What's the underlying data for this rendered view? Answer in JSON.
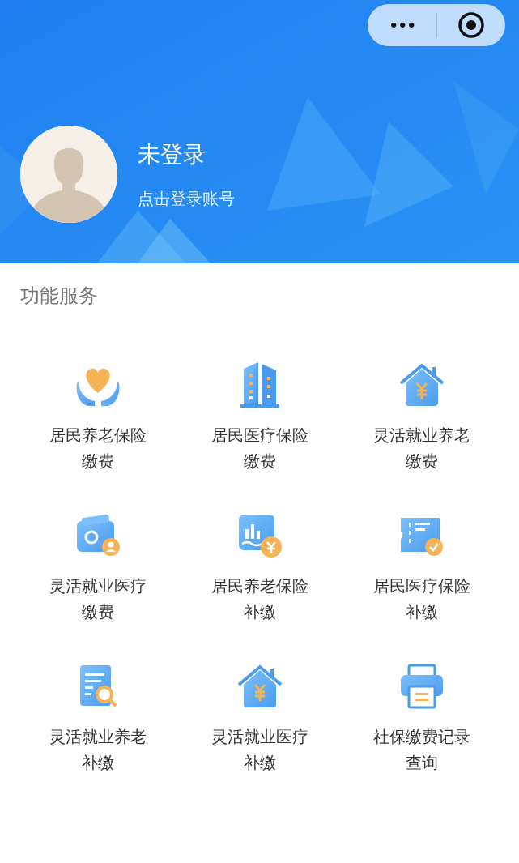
{
  "capsule": {
    "more_label": "•••"
  },
  "profile": {
    "name": "未登录",
    "hint": "点击登录账号"
  },
  "section": {
    "title": "功能服务"
  },
  "services": [
    {
      "label_lines": [
        "居民养老保险",
        "缴费"
      ]
    },
    {
      "label_lines": [
        "居民医疗保险",
        "缴费"
      ]
    },
    {
      "label_lines": [
        "灵活就业养老",
        "缴费"
      ]
    },
    {
      "label_lines": [
        "灵活就业医疗",
        "缴费"
      ]
    },
    {
      "label_lines": [
        "居民养老保险",
        "补缴"
      ]
    },
    {
      "label_lines": [
        "居民医疗保险",
        "补缴"
      ]
    },
    {
      "label_lines": [
        "灵活就业养老",
        "补缴"
      ]
    },
    {
      "label_lines": [
        "灵活就业医疗",
        "补缴"
      ]
    },
    {
      "label_lines": [
        "社保缴费记录",
        "查询"
      ]
    }
  ]
}
